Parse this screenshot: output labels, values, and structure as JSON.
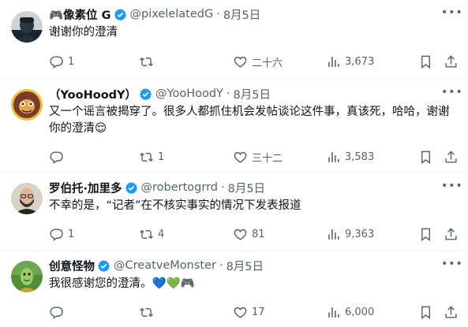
{
  "tweets": [
    {
      "name": "🎮像素位 G",
      "handle": "@pixelelatedG",
      "date": "8月5日",
      "text": "谢谢你的澄清",
      "reply_count": "1",
      "retweet_count": "",
      "like_count": "二十六",
      "view_count": "3,673",
      "verified": true
    },
    {
      "name": "（YooHoodY）",
      "handle": "@YooHoodY",
      "date": "8月5日",
      "text": "又一个谣言被揭穿了。很多人都抓住机会发帖谈论这件事，真该死，哈哈，谢谢你的澄清😌",
      "reply_count": "",
      "retweet_count": "1",
      "like_count": "三十二",
      "view_count": "3,583",
      "verified": true
    },
    {
      "name": "罗伯托·加里多",
      "handle": "@robertogrrd",
      "date": "8月5日",
      "text": "不幸的是，“记者”在不核实事实的情况下发表报道",
      "reply_count": "1",
      "retweet_count": "4",
      "like_count": "81",
      "view_count": "9,363",
      "verified": true
    },
    {
      "name": "创意怪物",
      "handle": "@CreatveMonster",
      "date": "8月5日",
      "text": "我很感谢您的澄清。💙💚🎮",
      "reply_count": "",
      "retweet_count": "",
      "like_count": "17",
      "view_count": "6,000",
      "verified": true
    }
  ],
  "separator": "·",
  "colors": {
    "verified": "#1d9bf0",
    "muted": "#536471",
    "text": "#0f1419",
    "divider": "#eff3f4"
  },
  "icons": [
    "reply-icon",
    "retweet-icon",
    "like-icon",
    "views-icon",
    "bookmark-icon",
    "share-icon",
    "more-icon",
    "verified-badge-icon"
  ]
}
